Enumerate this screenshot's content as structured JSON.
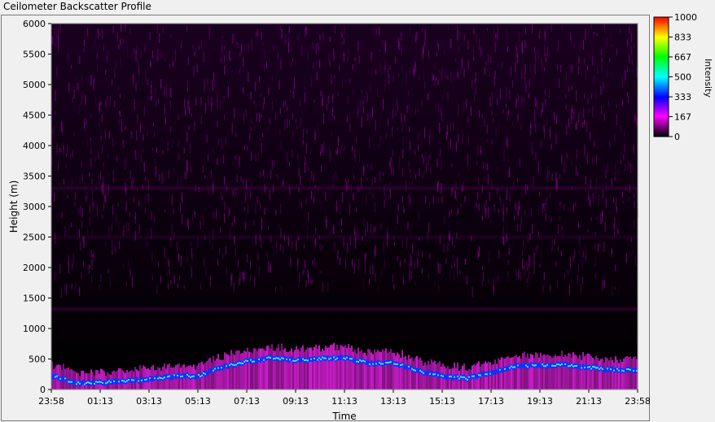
{
  "window": {
    "title": "Ceilometer Backscatter Profile"
  },
  "chart_data": {
    "type": "heatmap",
    "title": "Ceilometer Backscatter Profile",
    "xlabel": "Time",
    "ylabel": "Height (m)",
    "ylim": [
      0,
      6000
    ],
    "x_ticks": [
      "23:58",
      "01:13",
      "03:13",
      "05:13",
      "07:13",
      "09:13",
      "11:13",
      "13:13",
      "15:13",
      "17:13",
      "19:13",
      "21:13",
      "23:58"
    ],
    "y_ticks": [
      0,
      500,
      1000,
      1500,
      2000,
      2500,
      3000,
      3500,
      4000,
      4500,
      5000,
      5500,
      6000
    ],
    "colorbar": {
      "label": "Intensity",
      "range": [
        0,
        1000
      ],
      "ticks": [
        0,
        167,
        333,
        500,
        667,
        833,
        1000
      ],
      "colors": [
        "#000000",
        "#ff00ff",
        "#0000ff",
        "#00ffff",
        "#00ff00",
        "#ffff00",
        "#ff0000"
      ]
    },
    "boundary_layer": {
      "time_hours": [
        0,
        1,
        2,
        3,
        4,
        5,
        6,
        7,
        8,
        9,
        10,
        11,
        12,
        13,
        14,
        15,
        16,
        17,
        18,
        19,
        20,
        21,
        22,
        23,
        24
      ],
      "height_m": [
        230,
        100,
        110,
        140,
        170,
        220,
        220,
        370,
        460,
        520,
        480,
        510,
        510,
        430,
        440,
        300,
        220,
        180,
        280,
        380,
        400,
        400,
        360,
        320,
        320
      ]
    }
  }
}
